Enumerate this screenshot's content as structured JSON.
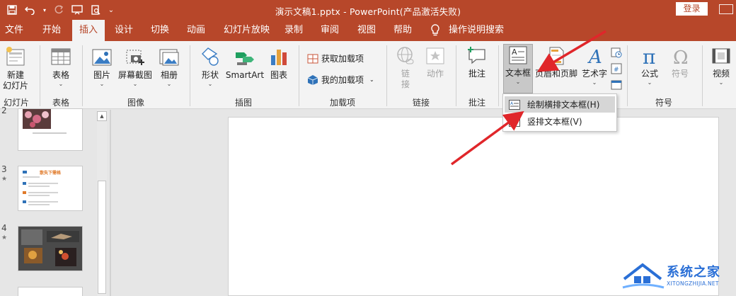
{
  "titlebar": {
    "title": "演示文稿1.pptx  -  PowerPoint(产品激活失败)",
    "login_label": "登录"
  },
  "tabs": [
    {
      "label": "文件"
    },
    {
      "label": "开始"
    },
    {
      "label": "插入"
    },
    {
      "label": "设计"
    },
    {
      "label": "切换"
    },
    {
      "label": "动画"
    },
    {
      "label": "幻灯片放映"
    },
    {
      "label": "录制"
    },
    {
      "label": "审阅"
    },
    {
      "label": "视图"
    },
    {
      "label": "帮助"
    },
    {
      "label": "操作说明搜索"
    }
  ],
  "ribbon": {
    "new_slide": "新建",
    "new_slide_2": "幻灯片",
    "table": "表格",
    "picture": "图片",
    "screenshot": "屏幕截图",
    "album": "相册",
    "shapes": "形状",
    "smartart": "SmartArt",
    "chart": "图表",
    "get_addins": "获取加载项",
    "my_addins": "我的加载项",
    "link": "链",
    "link_2": "接",
    "action": "动作",
    "comment": "批注",
    "textbox": "文本框",
    "header_footer": "页眉和页脚",
    "wordart": "艺术字",
    "equation": "公式",
    "symbol": "符号",
    "video": "视频",
    "groups": {
      "slides": "幻灯片",
      "tables": "表格",
      "images": "图像",
      "illustrations": "插图",
      "addins": "加载项",
      "links": "链接",
      "comments": "批注",
      "symbols": "符号"
    }
  },
  "menu": {
    "item1": "绘制横排文本框(H)",
    "item2": "竖排文本框(V)"
  },
  "slides": {
    "n2": "2",
    "n3": "3",
    "n4": "4",
    "star": "★",
    "thumb3_title": "散失下需格"
  },
  "watermark": {
    "text": "系统之家",
    "sub": "XITONGZHIJIA.NET"
  },
  "colors": {
    "accent": "#b7472a",
    "arrow": "#e0262a",
    "watermark": "#2a6fd6"
  }
}
